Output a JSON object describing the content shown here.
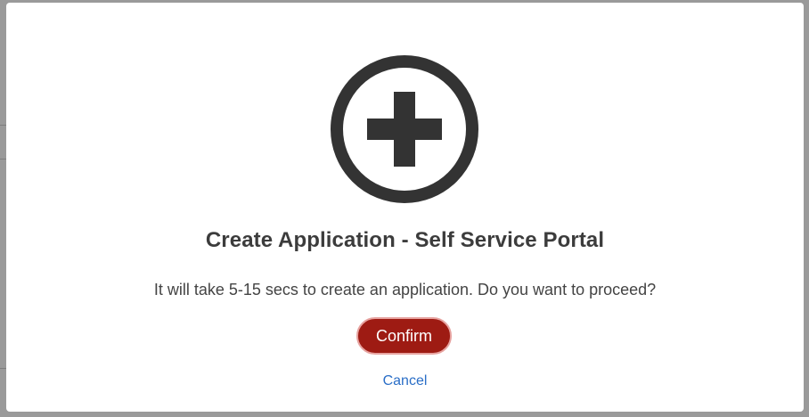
{
  "modal": {
    "icon": "plus-circle-icon",
    "title": "Create Application - Self Service Portal",
    "message": "It will take 5-15 secs to create an application. Do you want to proceed?",
    "confirm_label": "Confirm",
    "cancel_label": "Cancel"
  },
  "colors": {
    "confirm_bg": "#9e1b13",
    "icon": "#333333",
    "link": "#2a6ec7"
  }
}
